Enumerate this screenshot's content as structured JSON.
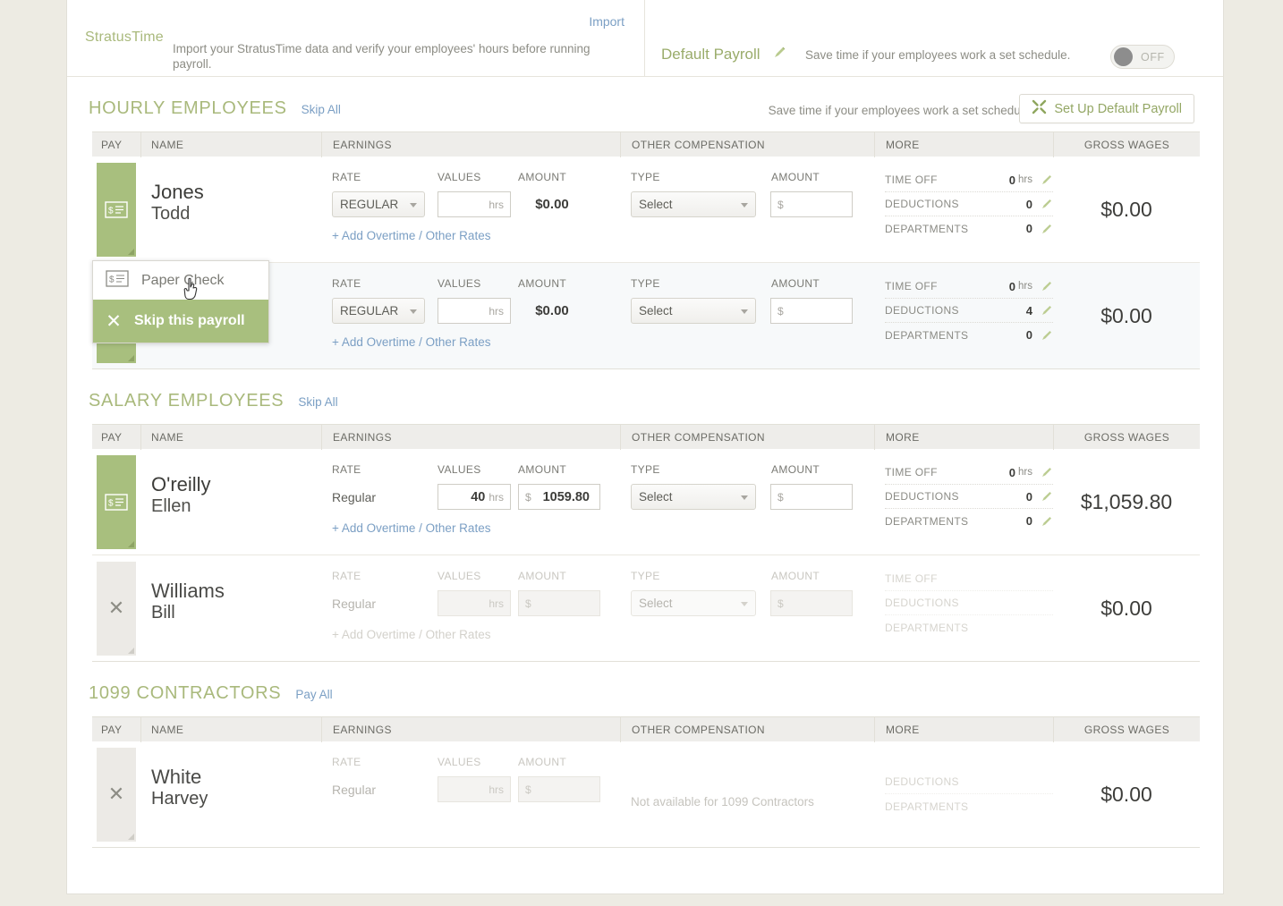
{
  "banner": {
    "stratustime_title": "StratusTime",
    "stratustime_desc": "Import your StratusTime data and verify your employees' hours before running payroll.",
    "import_link": "Import",
    "default_payroll_title": "Default Payroll",
    "default_payroll_desc": "Save time if your employees work a set schedule.",
    "toggle_label": "OFF",
    "pencil_icon": "pencil-icon"
  },
  "columns": {
    "pay": "PAY",
    "name": "NAME",
    "earnings": "EARNINGS",
    "other_compensation": "OTHER COMPENSATION",
    "more": "MORE",
    "gross_wages": "GROSS WAGES"
  },
  "field_labels": {
    "rate": "RATE",
    "values": "VALUES",
    "amount": "AMOUNT",
    "type": "TYPE",
    "time_off": "TIME OFF",
    "deductions": "DEDUCTIONS",
    "departments": "DEPARTMENTS",
    "add_rates": "+ Add Overtime / Other Rates",
    "hrs_placeholder": "hrs",
    "dollar_placeholder": "$",
    "not_available": "Not available for 1099 Contractors"
  },
  "sections": [
    {
      "title": "HOURLY EMPLOYEES",
      "action_link": "Skip All",
      "note": "Save time if your employees work a set schedule.",
      "setup_button": "Set Up Default Payroll",
      "setup_icon": "tools-icon",
      "rows": [
        {
          "pay_state": "active",
          "pay_icon": "paycheck-icon",
          "last_name": "Jones",
          "first_name": "Todd",
          "rate_type": "REGULAR",
          "rate_is_select": true,
          "hours": "",
          "amount": "$0.00",
          "amount_is_static": true,
          "other_type": "Select",
          "other_amount": "",
          "time_off": "0",
          "time_off_unit": "hrs",
          "deductions": "0",
          "departments": "0",
          "gross_wages": "$0.00"
        },
        {
          "pay_state": "menu-open",
          "pay_icon": "paycheck-icon",
          "last_name": "",
          "first_name": "",
          "rate_type": "REGULAR",
          "rate_is_select": true,
          "hours": "",
          "amount": "$0.00",
          "amount_is_static": true,
          "other_type": "Select",
          "other_amount": "",
          "time_off": "0",
          "time_off_unit": "hrs",
          "deductions": "4",
          "departments": "0",
          "gross_wages": "$0.00",
          "menu": {
            "paper_check": "Paper Check",
            "paper_check_icon": "paycheck-icon",
            "skip": "Skip this payroll",
            "skip_icon": "close-icon"
          }
        }
      ]
    },
    {
      "title": "SALARY EMPLOYEES",
      "action_link": "Skip All",
      "rows": [
        {
          "pay_state": "active",
          "pay_icon": "paycheck-icon",
          "last_name": "O'reilly",
          "first_name": "Ellen",
          "rate_type": "Regular",
          "rate_is_select": false,
          "hours": "40",
          "hours_unit": "hrs",
          "amount": "1059.80",
          "amount_prefix": "$",
          "amount_is_static": false,
          "other_type": "Select",
          "other_amount": "",
          "time_off": "0",
          "time_off_unit": "hrs",
          "deductions": "0",
          "departments": "0",
          "gross_wages": "$1,059.80"
        },
        {
          "pay_state": "skipped",
          "pay_icon": "close-icon",
          "last_name": "Williams",
          "first_name": "Bill",
          "rate_type": "Regular",
          "rate_is_select": false,
          "hours": "",
          "amount": "",
          "amount_is_static": false,
          "disabled": true,
          "other_type": "Select",
          "other_amount": "",
          "time_off": "",
          "deductions": "",
          "departments": "",
          "gross_wages": "$0.00"
        }
      ]
    },
    {
      "title": "1099 CONTRACTORS",
      "action_link": "Pay All",
      "rows": [
        {
          "pay_state": "skipped",
          "pay_icon": "close-icon",
          "last_name": "White",
          "first_name": "Harvey",
          "rate_type": "Regular",
          "rate_is_select": false,
          "hours": "",
          "amount": "",
          "disabled": true,
          "contractor": true,
          "deductions": "",
          "departments": "",
          "gross_wages": "$0.00"
        }
      ]
    }
  ],
  "colors": {
    "brand_green": "#a8bf7e",
    "title_green": "#a9b97c",
    "link_blue": "#7b9fc4",
    "page_bg": "#edebe3"
  }
}
